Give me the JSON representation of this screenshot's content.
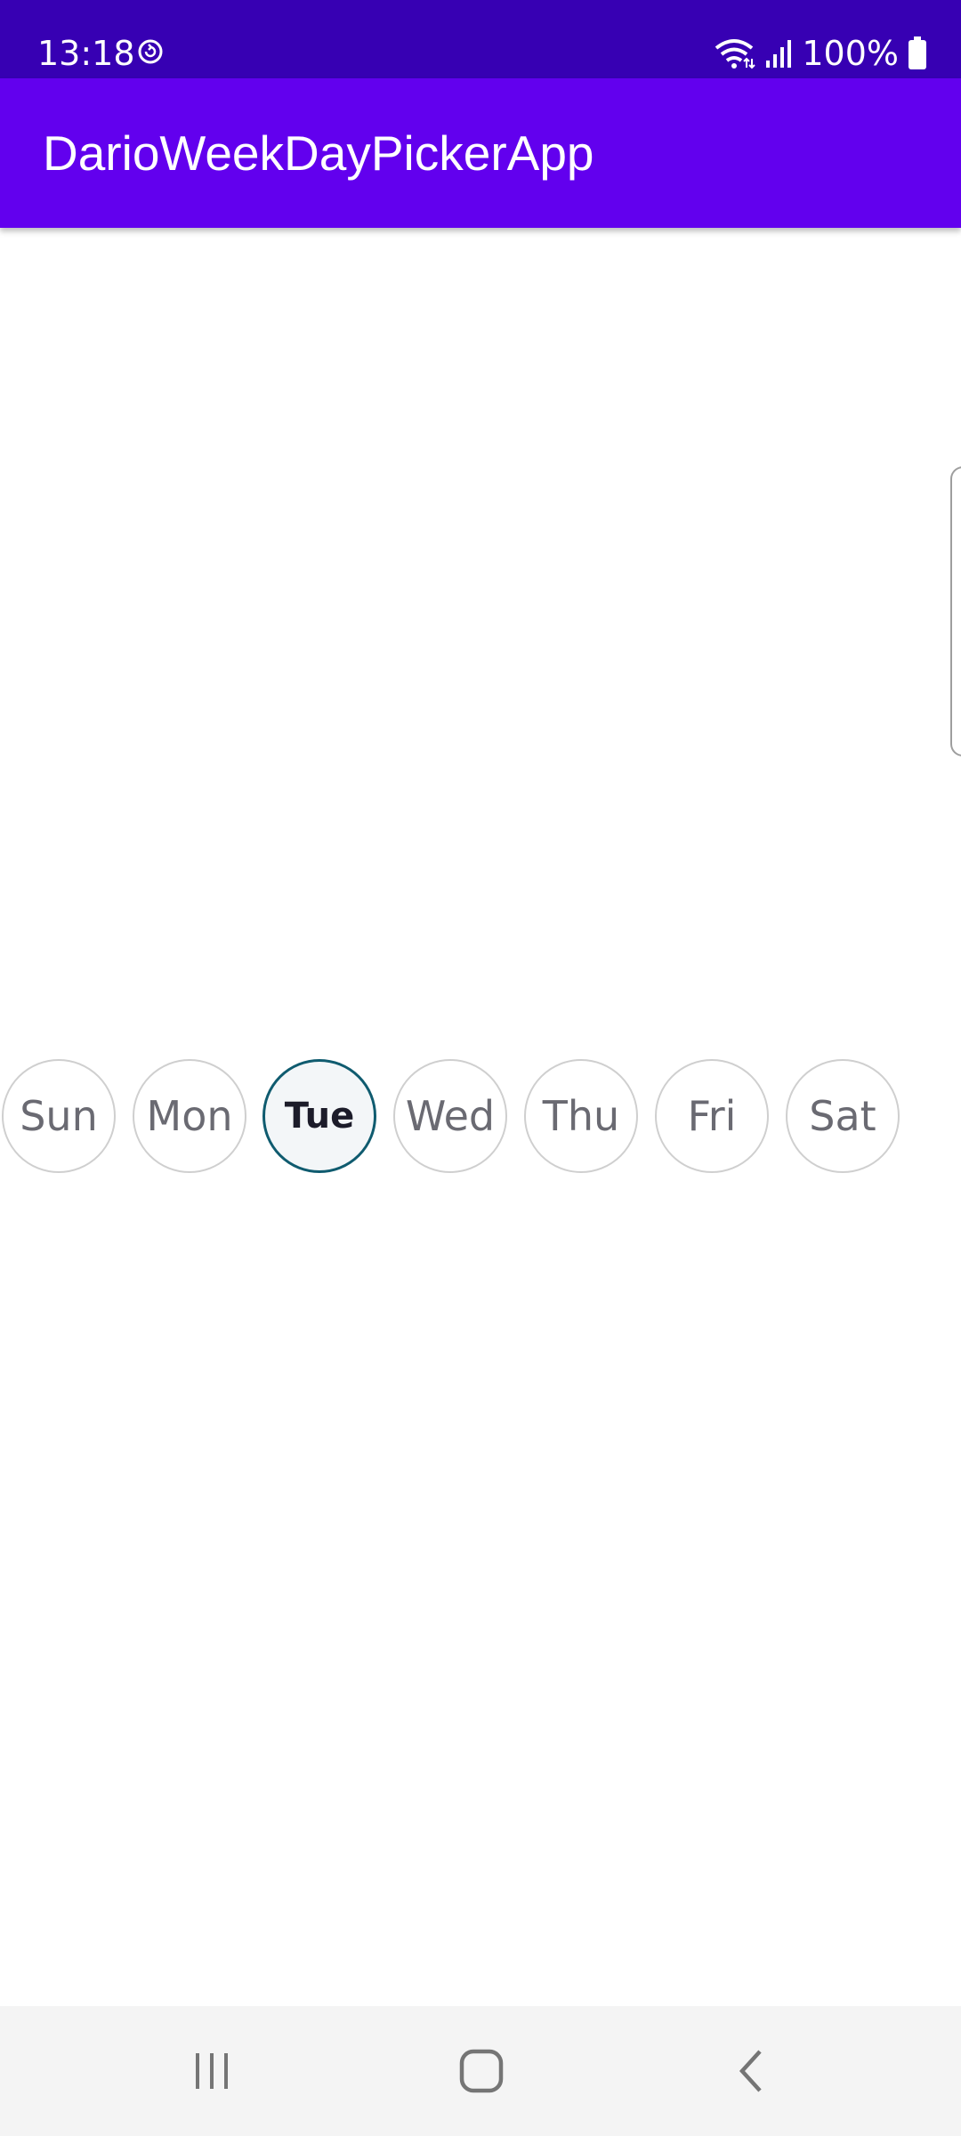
{
  "status_bar": {
    "time": "13:18",
    "battery": "100%",
    "icons": [
      "sync-icon",
      "wifi-icon",
      "signal-icon",
      "battery-icon"
    ]
  },
  "app_bar": {
    "title": "DarioWeekDayPickerApp",
    "color": "#6200ee",
    "status_color": "#3700b3"
  },
  "week_picker": {
    "days": [
      {
        "label": "Sun",
        "selected": false
      },
      {
        "label": "Mon",
        "selected": false
      },
      {
        "label": "Tue",
        "selected": true
      },
      {
        "label": "Wed",
        "selected": false
      },
      {
        "label": "Thu",
        "selected": false
      },
      {
        "label": "Fri",
        "selected": false
      },
      {
        "label": "Sat",
        "selected": false
      }
    ],
    "selected_border_color": "#0f5b6f",
    "unselected_border_color": "#cfcfcf"
  },
  "nav_bar": {
    "buttons": [
      "recent-apps-icon",
      "home-icon",
      "back-icon"
    ]
  }
}
